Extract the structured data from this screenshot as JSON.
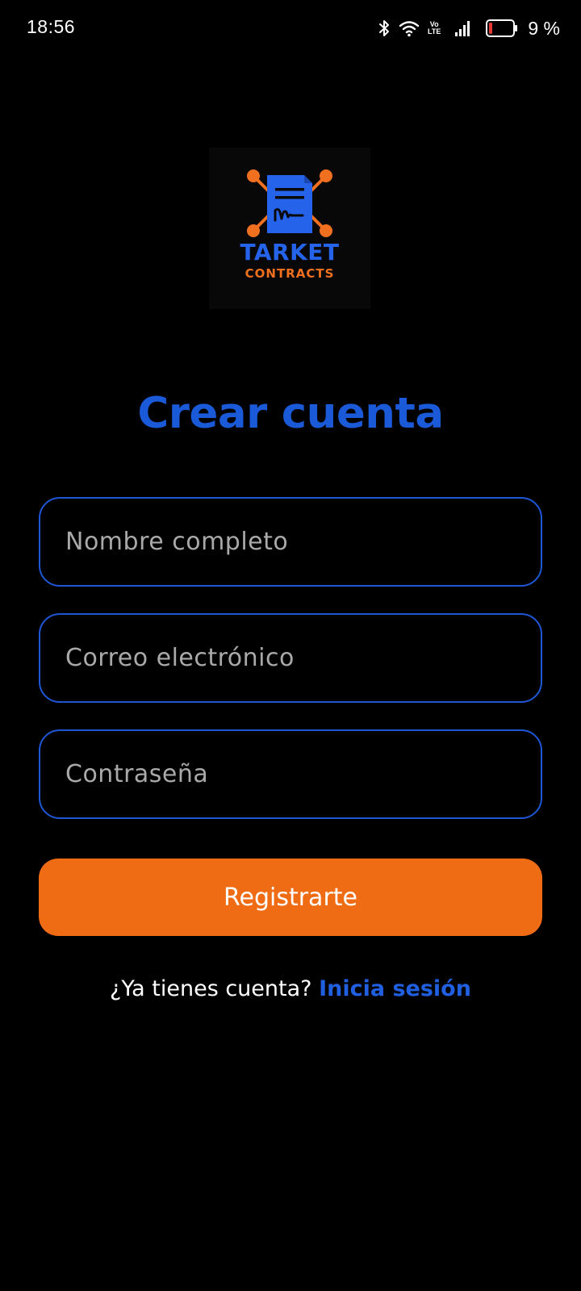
{
  "status_bar": {
    "time": "18:56",
    "volte_top": "Vo",
    "volte_bottom": "LTE",
    "battery_percent": "9 %",
    "icons": [
      "bluetooth-icon",
      "wifi-icon",
      "volte-icon",
      "signal-icon",
      "battery-icon"
    ],
    "battery_level": 0.09,
    "battery_color": "#e53935"
  },
  "logo": {
    "title": "TARKET",
    "subtitle": "CONTRACTS",
    "colors": {
      "primary": "#2563eb",
      "accent": "#f07020"
    }
  },
  "form": {
    "title": "Crear cuenta",
    "name_placeholder": "Nombre completo",
    "email_placeholder": "Correo electrónico",
    "password_placeholder": "Contraseña",
    "name_value": "",
    "email_value": "",
    "password_value": "",
    "submit_label": "Registrarte"
  },
  "login_prompt": {
    "text": "¿Ya tienes cuenta? ",
    "link": "Inicia sesión"
  },
  "colors": {
    "background": "#000000",
    "brand_blue": "#1a5ad8",
    "brand_orange": "#ef6c15",
    "field_border": "#1f56d6"
  }
}
